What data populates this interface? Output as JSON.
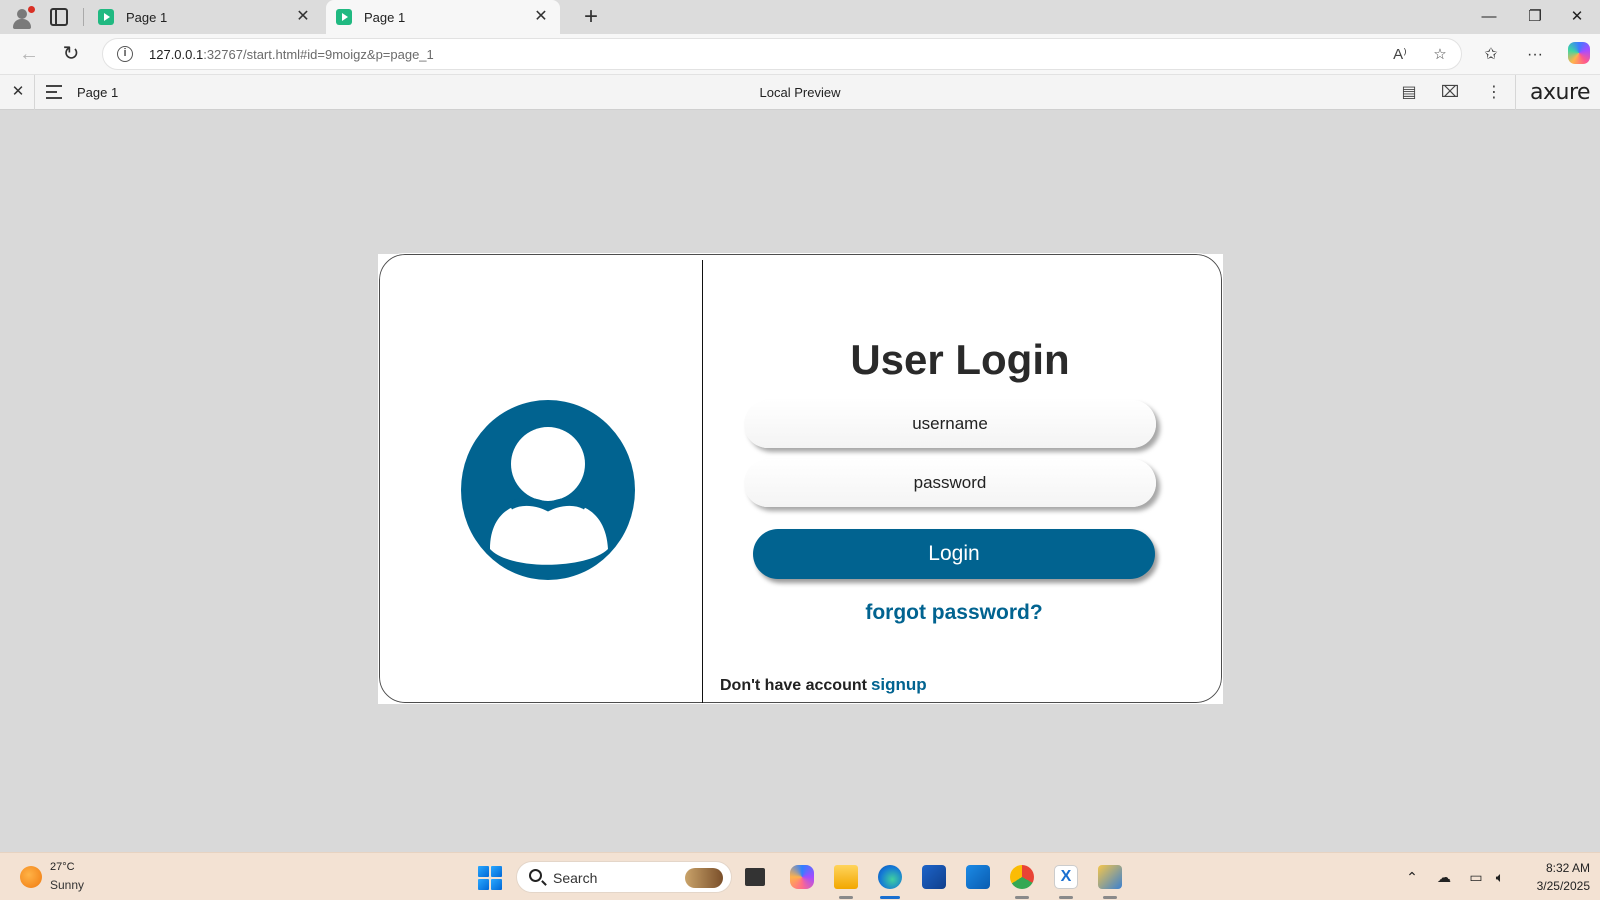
{
  "browser": {
    "tabs": [
      {
        "title": "Page 1",
        "active": false
      },
      {
        "title": "Page 1",
        "active": true
      }
    ],
    "url": {
      "host": "127.0.0.1",
      "rest": ":32767/start.html#id=9moigz&p=page_1"
    }
  },
  "axure": {
    "page_label": "Page 1",
    "preview_label": "Local Preview",
    "logo": "axure"
  },
  "login": {
    "title": "User Login",
    "username_placeholder": "username",
    "password_placeholder": "password",
    "login_label": "Login",
    "forgot_label": "forgot password?",
    "no_account_label": "Don't have account",
    "signup_label": "signup",
    "accent_color": "#016390"
  },
  "taskbar": {
    "weather_temp": "27°C",
    "weather_condition": "Sunny",
    "search_placeholder": "Search",
    "time": "8:32 AM",
    "date": "3/25/2025",
    "apps": [
      "task-view",
      "copilot",
      "file-explorer",
      "edge",
      "microsoft-store",
      "outlook",
      "chrome",
      "axure",
      "python"
    ]
  }
}
